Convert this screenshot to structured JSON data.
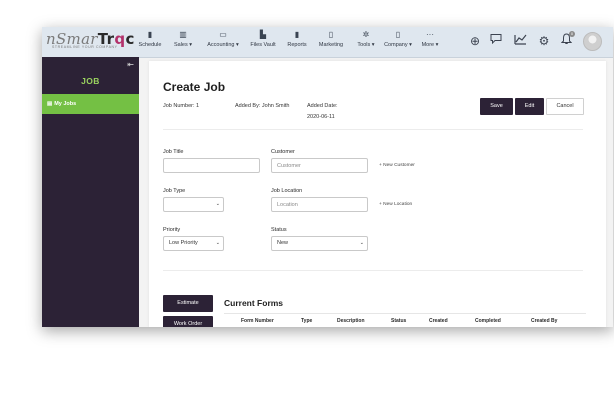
{
  "app": {
    "logo": {
      "prefix": "n",
      "smar": "Smar",
      "tr": "Tr",
      "q": "q",
      "c": "c",
      "tagline": "STREAMLINE YOUR COMPANY"
    }
  },
  "nav": [
    {
      "label": "Schedule",
      "icon": "bookmark-icon",
      "glyph": "▮"
    },
    {
      "label": "Sales ▾",
      "icon": "chart-icon",
      "glyph": "▥"
    },
    {
      "label": "Accounting ▾",
      "icon": "money-icon",
      "glyph": "▭"
    },
    {
      "label": "Files Vault",
      "icon": "bars-icon",
      "glyph": "▙"
    },
    {
      "label": "Reports",
      "icon": "bookmark-icon",
      "glyph": "▮"
    },
    {
      "label": "Marketing",
      "icon": "document-icon",
      "glyph": "▯"
    },
    {
      "label": "Tools ▾",
      "icon": "gear-icon",
      "glyph": "✲"
    },
    {
      "label": "Company ▾",
      "icon": "building-icon",
      "glyph": "▯"
    },
    {
      "label": "More ▾",
      "icon": "ellipsis-icon",
      "glyph": "···"
    }
  ],
  "toolbar_icons": [
    {
      "name": "add-circle-icon",
      "glyph": "⊕"
    },
    {
      "name": "chat-icon",
      "glyph": "💬"
    },
    {
      "name": "trend-icon",
      "glyph": "↗"
    },
    {
      "name": "settings-gear-icon",
      "glyph": "⚙"
    },
    {
      "name": "bell-icon",
      "glyph": "🔔"
    }
  ],
  "notification_count": "0",
  "sidebar": {
    "collapse_glyph": "⇤",
    "title": "JOB",
    "item_icon": "▤",
    "item_label": "My Jobs"
  },
  "page": {
    "title": "Create Job",
    "job_number": "Job Number: 1",
    "added_by": "Added By: John Smith",
    "added_date_label": "Added Date:",
    "added_date": "2020-06-11",
    "buttons": {
      "save": "Save",
      "edit": "Edit",
      "cancel": "Cancel"
    }
  },
  "form": {
    "job_title": {
      "label": "Job Title",
      "value": ""
    },
    "customer": {
      "label": "Customer",
      "placeholder": "Customer"
    },
    "new_customer": "+ New Customer",
    "job_type": {
      "label": "Job Type",
      "value": ""
    },
    "job_location": {
      "label": "Job Location",
      "placeholder": "Location"
    },
    "new_location": "+ New Location",
    "priority": {
      "label": "Priority",
      "value": "Low Priority"
    },
    "status": {
      "label": "Status",
      "value": "New"
    }
  },
  "forms_section": {
    "tabs": [
      "Estimate",
      "Work Order"
    ],
    "title": "Current Forms",
    "columns": [
      "Form Number",
      "Type",
      "Description",
      "Status",
      "Created",
      "Completed",
      "Created By"
    ]
  },
  "colors": {
    "sidebar": "#2c2236",
    "accent_green": "#74c044",
    "primary_button": "#2c2236"
  }
}
